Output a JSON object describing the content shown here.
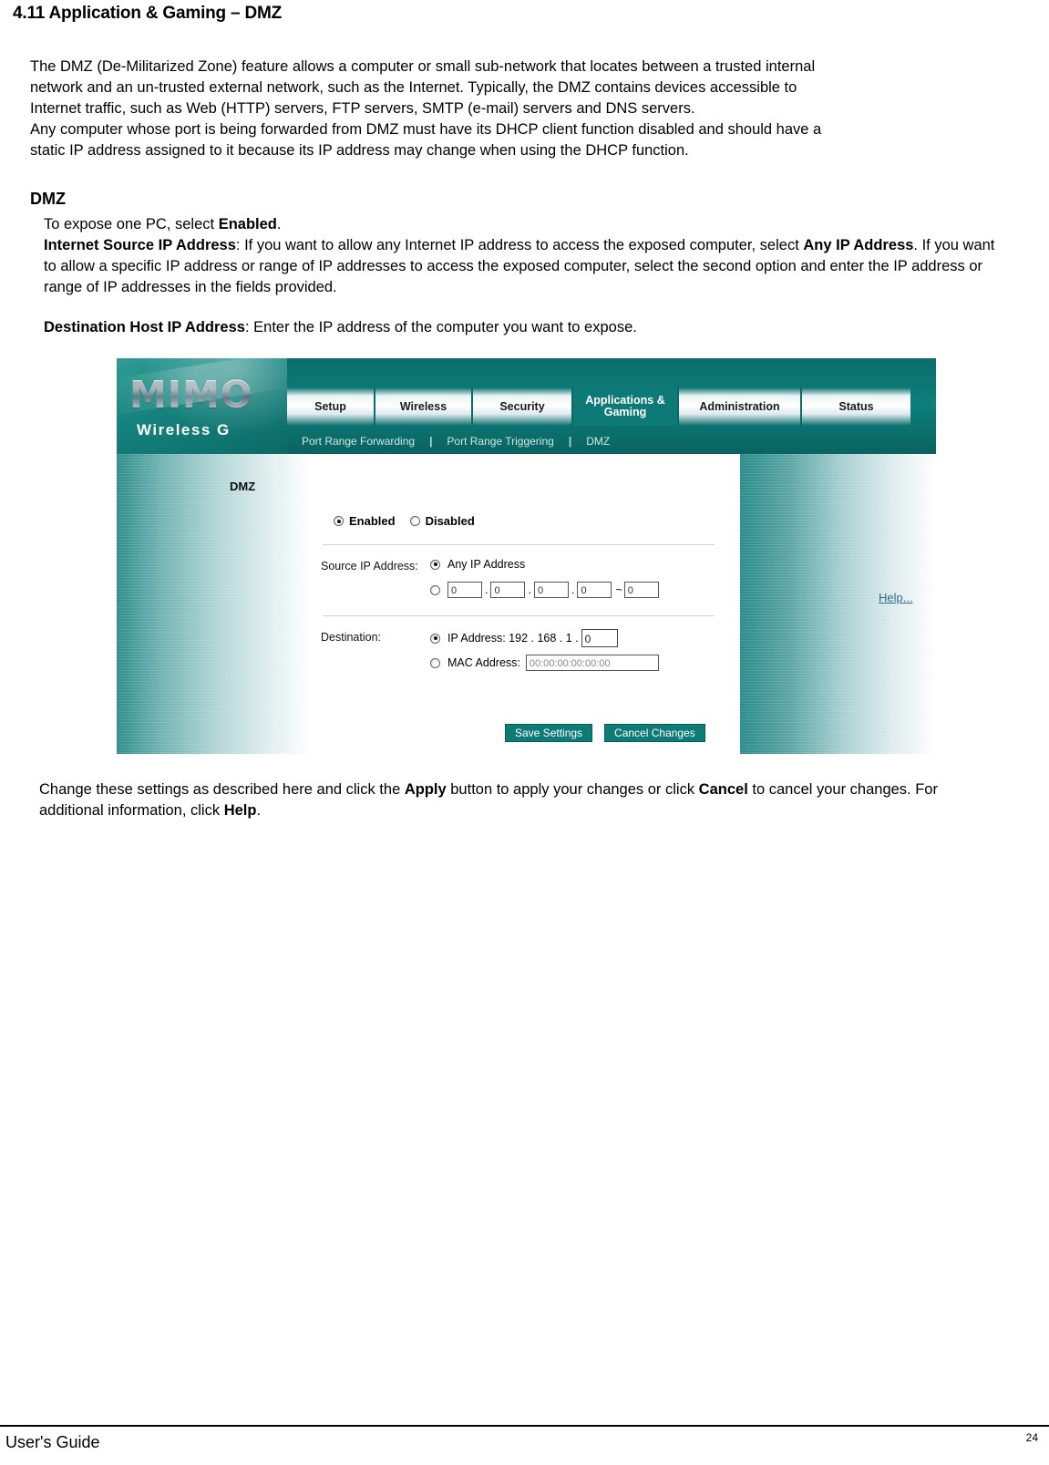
{
  "document": {
    "section_title": "4.11 Application & Gaming – DMZ",
    "intro_paragraph_lines": [
      "The DMZ (De-Militarized Zone) feature allows a computer or small sub-network that locates between a trusted internal",
      "network and an un-trusted external network, such as the Internet. Typically, the DMZ contains devices accessible to",
      "Internet traffic, such as Web (HTTP) servers, FTP servers, SMTP (e-mail) servers and DNS servers.",
      "Any computer whose port is being forwarded from DMZ must have its DHCP client function disabled and should have a",
      "static IP address assigned to it because its IP address may change when using the DHCP function."
    ],
    "dmz_heading": "DMZ",
    "dmz_line1_pre": "To expose one PC, select ",
    "dmz_line1_bold": "Enabled",
    "dmz_line1_post": ".",
    "dmz_line2_bold": "Internet Source IP Address",
    "dmz_line2_text": ": If you want to allow any Internet IP address to access the exposed computer, select ",
    "dmz_line2_bold2": "Any IP Address",
    "dmz_line2_text2": ". If you want to allow a specific IP address or range of IP addresses to access the exposed computer, select the second option and enter the IP address or range of IP addresses in the fields provided.",
    "dest_bold": "Destination Host IP Address",
    "dest_text": ": Enter the IP address of the computer you want to expose.",
    "closing_pre": "Change these settings as described here and click the ",
    "closing_bold1": "Apply",
    "closing_mid": " button to apply your changes or click ",
    "closing_bold2": "Cancel",
    "closing_post": " to cancel your changes. For additional information, click ",
    "closing_bold3": "Help",
    "closing_end": ".",
    "footer_left": "User's Guide",
    "footer_page": "24"
  },
  "router_ui": {
    "brand_name": "MIMO",
    "brand_sub": "Wireless G",
    "tabs": [
      {
        "label": "Setup",
        "active": false
      },
      {
        "label": "Wireless",
        "active": false
      },
      {
        "label": "Security",
        "active": false
      },
      {
        "label": "Applications & Gaming",
        "active": true
      },
      {
        "label": "Administration",
        "active": false
      },
      {
        "label": "Status",
        "active": false
      }
    ],
    "subnav": [
      "Port Range Forwarding",
      "Port Range Triggering",
      "DMZ"
    ],
    "subnav_separator": "|",
    "section_label": "DMZ",
    "help_link": "Help...",
    "enable_radios": {
      "enabled_label": "Enabled",
      "disabled_label": "Disabled",
      "selected": "Enabled"
    },
    "source": {
      "label": "Source IP Address:",
      "any_option_label": "Any IP Address",
      "selected": "any",
      "octets": [
        "0",
        "0",
        "0",
        "0"
      ],
      "range_end": "0",
      "dot": ".",
      "tilde": "~"
    },
    "destination": {
      "label": "Destination:",
      "selected": "ip",
      "ip_prefix_label": "IP Address: 192 . 168 . 1 .",
      "ip_last_octet": "0",
      "mac_label": "MAC Address:",
      "mac_value": "00:00:00:00:00:00"
    },
    "buttons": {
      "save": "Save Settings",
      "cancel": "Cancel Changes"
    },
    "colors": {
      "teal": "#0d7a77",
      "teal_dark": "#0a6360",
      "help_link": "#2e6b86"
    }
  }
}
